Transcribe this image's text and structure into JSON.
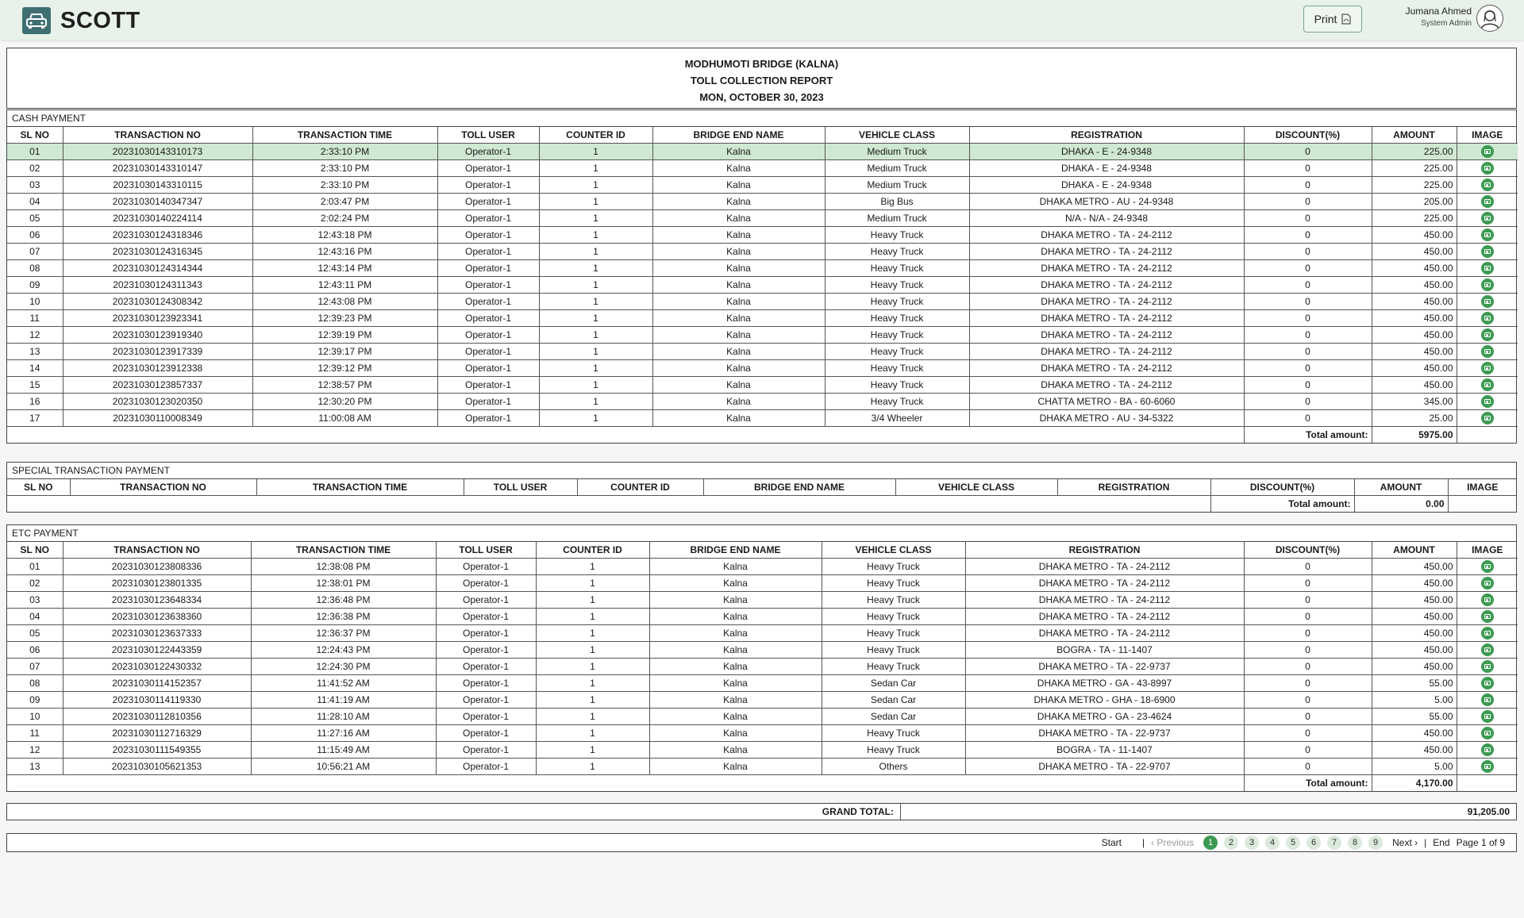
{
  "app": {
    "name": "SCOTT",
    "print_label": "Print"
  },
  "user": {
    "name": "Jumana Ahmed",
    "role": "System Admin"
  },
  "report": {
    "bridge": "MODHUMOTI BRIDGE (KALNA)",
    "title": "TOLL COLLECTION REPORT",
    "date": "MON, OCTOBER 30, 2023"
  },
  "columns": [
    "SL NO",
    "TRANSACTION NO",
    "TRANSACTION TIME",
    "TOLL USER",
    "COUNTER ID",
    "BRIDGE END NAME",
    "VEHICLE CLASS",
    "REGISTRATION",
    "DISCOUNT(%)",
    "AMOUNT",
    "IMAGE"
  ],
  "cash": {
    "label": "CASH PAYMENT",
    "total_label": "Total amount:",
    "total": "5975.00",
    "rows": [
      [
        "01",
        "20231030143310173",
        "2:33:10 PM",
        "Operator-1",
        "1",
        "Kalna",
        "Medium Truck",
        "DHAKA - E - 24-9348",
        "0",
        "225.00"
      ],
      [
        "02",
        "20231030143310147",
        "2:33:10 PM",
        "Operator-1",
        "1",
        "Kalna",
        "Medium Truck",
        "DHAKA - E - 24-9348",
        "0",
        "225.00"
      ],
      [
        "03",
        "20231030143310115",
        "2:33:10 PM",
        "Operator-1",
        "1",
        "Kalna",
        "Medium Truck",
        "DHAKA - E - 24-9348",
        "0",
        "225.00"
      ],
      [
        "04",
        "20231030140347347",
        "2:03:47 PM",
        "Operator-1",
        "1",
        "Kalna",
        "Big Bus",
        "DHAKA METRO - AU - 24-9348",
        "0",
        "205.00"
      ],
      [
        "05",
        "20231030140224114",
        "2:02:24 PM",
        "Operator-1",
        "1",
        "Kalna",
        "Medium Truck",
        "N/A - N/A - 24-9348",
        "0",
        "225.00"
      ],
      [
        "06",
        "20231030124318346",
        "12:43:18 PM",
        "Operator-1",
        "1",
        "Kalna",
        "Heavy Truck",
        "DHAKA METRO - TA - 24-2112",
        "0",
        "450.00"
      ],
      [
        "07",
        "20231030124316345",
        "12:43:16 PM",
        "Operator-1",
        "1",
        "Kalna",
        "Heavy Truck",
        "DHAKA METRO - TA - 24-2112",
        "0",
        "450.00"
      ],
      [
        "08",
        "20231030124314344",
        "12:43:14 PM",
        "Operator-1",
        "1",
        "Kalna",
        "Heavy Truck",
        "DHAKA METRO - TA - 24-2112",
        "0",
        "450.00"
      ],
      [
        "09",
        "20231030124311343",
        "12:43:11 PM",
        "Operator-1",
        "1",
        "Kalna",
        "Heavy Truck",
        "DHAKA METRO - TA - 24-2112",
        "0",
        "450.00"
      ],
      [
        "10",
        "20231030124308342",
        "12:43:08 PM",
        "Operator-1",
        "1",
        "Kalna",
        "Heavy Truck",
        "DHAKA METRO - TA - 24-2112",
        "0",
        "450.00"
      ],
      [
        "11",
        "20231030123923341",
        "12:39:23 PM",
        "Operator-1",
        "1",
        "Kalna",
        "Heavy Truck",
        "DHAKA METRO - TA - 24-2112",
        "0",
        "450.00"
      ],
      [
        "12",
        "20231030123919340",
        "12:39:19 PM",
        "Operator-1",
        "1",
        "Kalna",
        "Heavy Truck",
        "DHAKA METRO - TA - 24-2112",
        "0",
        "450.00"
      ],
      [
        "13",
        "20231030123917339",
        "12:39:17 PM",
        "Operator-1",
        "1",
        "Kalna",
        "Heavy Truck",
        "DHAKA METRO - TA - 24-2112",
        "0",
        "450.00"
      ],
      [
        "14",
        "20231030123912338",
        "12:39:12 PM",
        "Operator-1",
        "1",
        "Kalna",
        "Heavy Truck",
        "DHAKA METRO - TA - 24-2112",
        "0",
        "450.00"
      ],
      [
        "15",
        "20231030123857337",
        "12:38:57 PM",
        "Operator-1",
        "1",
        "Kalna",
        "Heavy Truck",
        "DHAKA METRO - TA - 24-2112",
        "0",
        "450.00"
      ],
      [
        "16",
        "20231030123020350",
        "12:30:20 PM",
        "Operator-1",
        "1",
        "Kalna",
        "Heavy Truck",
        "CHATTA METRO - BA - 60-6060",
        "0",
        "345.00"
      ],
      [
        "17",
        "20231030110008349",
        "11:00:08 AM",
        "Operator-1",
        "1",
        "Kalna",
        "3/4 Wheeler",
        "DHAKA METRO - AU - 34-5322",
        "0",
        "25.00"
      ]
    ]
  },
  "special": {
    "label": "SPECIAL TRANSACTION PAYMENT",
    "total_label": "Total amount:",
    "total": "0.00"
  },
  "etc": {
    "label": "ETC PAYMENT",
    "total_label": "Total amount:",
    "total": "4,170.00",
    "rows": [
      [
        "01",
        "20231030123808336",
        "12:38:08 PM",
        "Operator-1",
        "1",
        "Kalna",
        "Heavy Truck",
        "DHAKA METRO - TA - 24-2112",
        "0",
        "450.00"
      ],
      [
        "02",
        "20231030123801335",
        "12:38:01 PM",
        "Operator-1",
        "1",
        "Kalna",
        "Heavy Truck",
        "DHAKA METRO - TA - 24-2112",
        "0",
        "450.00"
      ],
      [
        "03",
        "20231030123648334",
        "12:36:48 PM",
        "Operator-1",
        "1",
        "Kalna",
        "Heavy Truck",
        "DHAKA METRO - TA - 24-2112",
        "0",
        "450.00"
      ],
      [
        "04",
        "20231030123638360",
        "12:36:38 PM",
        "Operator-1",
        "1",
        "Kalna",
        "Heavy Truck",
        "DHAKA METRO - TA - 24-2112",
        "0",
        "450.00"
      ],
      [
        "05",
        "20231030123637333",
        "12:36:37 PM",
        "Operator-1",
        "1",
        "Kalna",
        "Heavy Truck",
        "DHAKA METRO - TA - 24-2112",
        "0",
        "450.00"
      ],
      [
        "06",
        "20231030122443359",
        "12:24:43 PM",
        "Operator-1",
        "1",
        "Kalna",
        "Heavy Truck",
        "BOGRA - TA - 11-1407",
        "0",
        "450.00"
      ],
      [
        "07",
        "20231030122430332",
        "12:24:30 PM",
        "Operator-1",
        "1",
        "Kalna",
        "Heavy Truck",
        "DHAKA METRO - TA - 22-9737",
        "0",
        "450.00"
      ],
      [
        "08",
        "20231030114152357",
        "11:41:52 AM",
        "Operator-1",
        "1",
        "Kalna",
        "Sedan Car",
        "DHAKA METRO - GA - 43-8997",
        "0",
        "55.00"
      ],
      [
        "09",
        "20231030114119330",
        "11:41:19 AM",
        "Operator-1",
        "1",
        "Kalna",
        "Sedan Car",
        "DHAKA METRO - GHA - 18-6900",
        "0",
        "5.00"
      ],
      [
        "10",
        "20231030112810356",
        "11:28:10 AM",
        "Operator-1",
        "1",
        "Kalna",
        "Sedan Car",
        "DHAKA METRO - GA - 23-4624",
        "0",
        "55.00"
      ],
      [
        "11",
        "20231030112716329",
        "11:27:16 AM",
        "Operator-1",
        "1",
        "Kalna",
        "Heavy Truck",
        "DHAKA METRO - TA - 22-9737",
        "0",
        "450.00"
      ],
      [
        "12",
        "20231030111549355",
        "11:15:49 AM",
        "Operator-1",
        "1",
        "Kalna",
        "Heavy Truck",
        "BOGRA - TA - 11-1407",
        "0",
        "450.00"
      ],
      [
        "13",
        "20231030105621353",
        "10:56:21 AM",
        "Operator-1",
        "1",
        "Kalna",
        "Others",
        "DHAKA METRO - TA - 22-9707",
        "0",
        "5.00"
      ]
    ]
  },
  "grand": {
    "label": "GRAND TOTAL:",
    "value": "91,205.00"
  },
  "pager": {
    "start": "Start",
    "sep": "|",
    "previous": "‹ Previous",
    "pages": [
      "1",
      "2",
      "3",
      "4",
      "5",
      "6",
      "7",
      "8",
      "9"
    ],
    "current_page": 1,
    "next": "Next ›",
    "end": "End",
    "info": "Page 1 of 9"
  }
}
